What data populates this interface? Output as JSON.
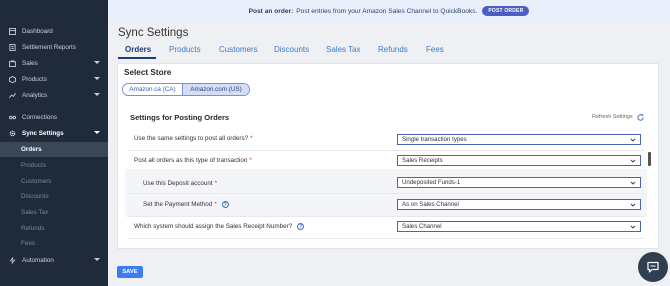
{
  "banner": {
    "bold": "Post an order:",
    "text": "Post entries from your Amazon Sales Channel to QuickBooks.",
    "button": "POST ORDER"
  },
  "sidebar": {
    "items": [
      {
        "label": "Dashboard",
        "icon": "dashboard-icon"
      },
      {
        "label": "Settlement Reports",
        "icon": "report-icon"
      },
      {
        "label": "Sales",
        "icon": "sales-icon"
      },
      {
        "label": "Products",
        "icon": "products-icon"
      },
      {
        "label": "Analytics",
        "icon": "analytics-icon"
      },
      {
        "label": "Connections",
        "icon": "connections-icon"
      },
      {
        "label": "Sync Settings",
        "icon": "gear-icon"
      },
      {
        "label": "Automation",
        "icon": "automation-icon"
      }
    ],
    "sub": [
      "Orders",
      "Products",
      "Customers",
      "Discounts",
      "Sales Tax",
      "Refunds",
      "Fees"
    ]
  },
  "page": {
    "title": "Sync Settings",
    "tabs": [
      "Orders",
      "Products",
      "Customers",
      "Discounts",
      "Sales Tax",
      "Refunds",
      "Fees"
    ]
  },
  "store": {
    "heading": "Select Store",
    "ca": "Amazon.ca (CA)",
    "us": "Amazon.com (US)"
  },
  "settings": {
    "title": "Settings for Posting Orders",
    "refresh": "Refresh Settings",
    "rows": [
      {
        "label": "Use the same settings to post all orders?",
        "value": "Single transaction types"
      },
      {
        "label": "Post all orders as this type of transaction",
        "value": "Sales Receipts"
      },
      {
        "label": "Use this Deposit account",
        "value": "Undeposited Funds-1"
      },
      {
        "label": "Set the Payment Method",
        "value": "As on Sales Channel"
      },
      {
        "label": "Which system should assign the Sales Receipt Number?",
        "value": "Sales Channel"
      }
    ],
    "required_mark": "*",
    "help_mark": "?"
  },
  "footer": {
    "save": "SAVE"
  },
  "colors": {
    "sidebar": "#1f2b3a",
    "accent": "#3c7bf0",
    "tab_active": "#1f3c7a"
  }
}
